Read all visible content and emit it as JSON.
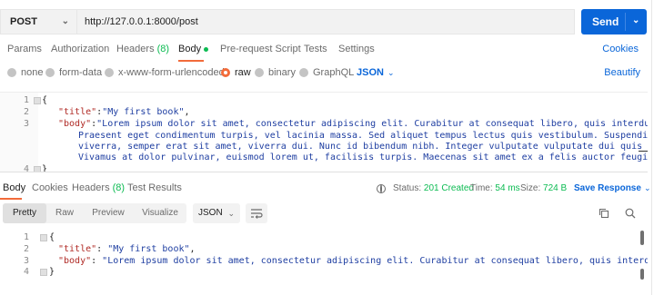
{
  "request": {
    "method": "POST",
    "url": "http://127.0.0.1:8000/post",
    "send_label": "Send"
  },
  "request_tabs": [
    {
      "label": "Params"
    },
    {
      "label": "Authorization"
    },
    {
      "label": "Headers",
      "count": "(8)"
    },
    {
      "label": "Body"
    },
    {
      "label": "Pre-request Script"
    },
    {
      "label": "Tests"
    },
    {
      "label": "Settings"
    }
  ],
  "cookies_link": "Cookies",
  "body_types": [
    {
      "label": "none"
    },
    {
      "label": "form-data"
    },
    {
      "label": "x-www-form-urlencoded"
    },
    {
      "label": "raw"
    },
    {
      "label": "binary"
    },
    {
      "label": "GraphQL"
    }
  ],
  "body_format": "JSON",
  "beautify_label": "Beautify",
  "request_body": {
    "line_numbers": [
      "1",
      "2",
      "3",
      "4"
    ],
    "brace_open": "{",
    "brace_close": "}",
    "title_key": "\"title\"",
    "title_value": "\"My first book\"",
    "body_key": "\"body\"",
    "body_value_lines": [
      "\"Lorem ipsum dolor sit amet, consectetur adipiscing elit. Curabitur at consequat libero, quis interdum odio.",
      "Praesent eget condimentum turpis, vel lacinia massa. Sed aliquet tempus lectus quis vestibulum. Suspendisse ac nulla",
      "viverra, semper erat sit amet, viverra dui. Nunc id bibendum nibh. Integer vulputate vulputate dui quis rhoncus.",
      "Vivamus at dolor pulvinar, euismod lorem ut, facilisis turpis. Maecenas sit amet ex a felis auctor feugiat\""
    ]
  },
  "response_tabs": [
    {
      "label": "Body"
    },
    {
      "label": "Cookies"
    },
    {
      "label": "Headers",
      "count": "(8)"
    },
    {
      "label": "Test Results"
    }
  ],
  "response_status": {
    "status_label": "Status:",
    "status_value": "201 Created",
    "time_label": "Time:",
    "time_value": "54 ms",
    "size_label": "Size:",
    "size_value": "724 B",
    "save_response": "Save Response"
  },
  "view_modes": [
    "Pretty",
    "Raw",
    "Preview",
    "Visualize"
  ],
  "response_format": "JSON",
  "response_body": {
    "line_numbers": [
      "1",
      "2",
      "3",
      "4"
    ],
    "brace_open": "{",
    "brace_close": "}",
    "title_key": "\"title\"",
    "title_value": "\"My first book\"",
    "body_key": "\"body\"",
    "body_value": "\"Lorem ipsum dolor sit amet, consectetur adipiscing elit. Curabitur at consequat libero, quis interdum odio. Praesent"
  },
  "colors": {
    "accent": "#0a66d9",
    "active_tab": "#f26b3a",
    "status_ok": "#0cbb52"
  }
}
